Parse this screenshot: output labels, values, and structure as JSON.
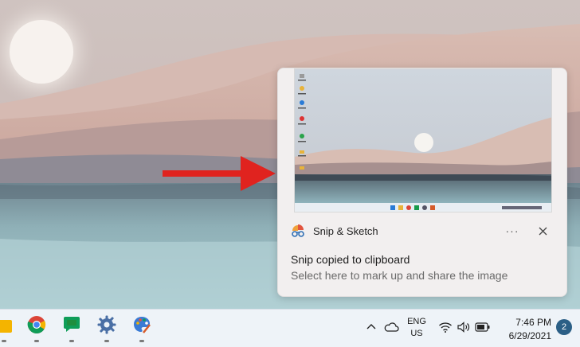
{
  "desktop": {
    "wallpaper": "desert-dunes-lake-wallpaper",
    "annotation": "red-arrow"
  },
  "toast": {
    "app_name": "Snip & Sketch",
    "title": "Snip copied to clipboard",
    "body": "Select here to mark up and share the image",
    "more_label": "···",
    "close_icon": "close-icon"
  },
  "taskbar": {
    "apps": [
      {
        "name": "file-explorer",
        "icon": "folder-icon"
      },
      {
        "name": "chrome",
        "icon": "chrome-icon"
      },
      {
        "name": "google-chat",
        "icon": "chat-icon"
      },
      {
        "name": "settings",
        "icon": "gear-icon"
      },
      {
        "name": "paint",
        "icon": "palette-icon"
      }
    ],
    "language": {
      "line1": "ENG",
      "line2": "US"
    },
    "clock": {
      "time": "7:46 PM",
      "date": "6/29/2021"
    },
    "notification_count": "2"
  },
  "colors": {
    "accent": "#2b5f86",
    "arrow": "#e0231f",
    "toast_bg": "#f2efef"
  }
}
